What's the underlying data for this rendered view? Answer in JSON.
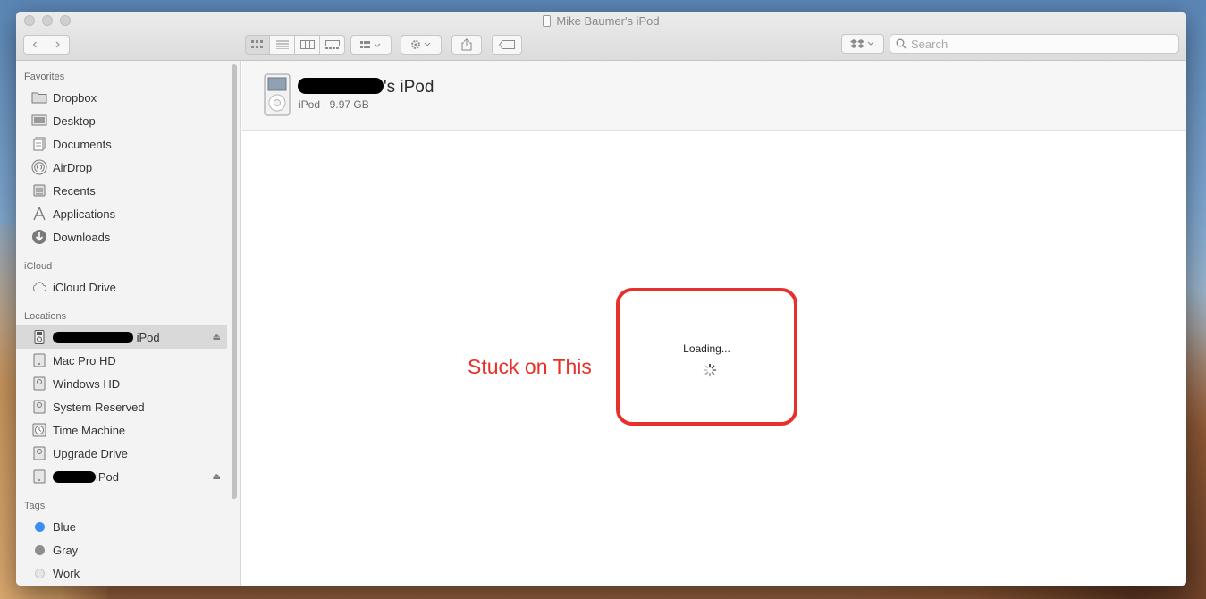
{
  "window": {
    "title": "Mike Baumer's iPod"
  },
  "toolbar": {
    "back_label": "‹",
    "forward_label": "›",
    "view_icons": [
      "icon-view-icon",
      "list-view-icon",
      "column-view-icon",
      "gallery-view-icon"
    ],
    "search_placeholder": "Search"
  },
  "sidebar": {
    "favorites_header": "Favorites",
    "favorites": [
      {
        "label": "Dropbox",
        "icon": "folder-icon"
      },
      {
        "label": "Desktop",
        "icon": "desktop-icon"
      },
      {
        "label": "Documents",
        "icon": "documents-icon"
      },
      {
        "label": "AirDrop",
        "icon": "airdrop-icon"
      },
      {
        "label": "Recents",
        "icon": "recents-icon"
      },
      {
        "label": "Applications",
        "icon": "applications-icon"
      },
      {
        "label": "Downloads",
        "icon": "downloads-icon"
      }
    ],
    "icloud_header": "iCloud",
    "icloud": [
      {
        "label": "iCloud Drive",
        "icon": "cloud-icon"
      }
    ],
    "locations_header": "Locations",
    "locations": [
      {
        "label": "iPod",
        "icon": "ipod-icon",
        "selected": true,
        "eject": true
      },
      {
        "label": "Mac Pro HD",
        "icon": "drive-icon"
      },
      {
        "label": "Windows HD",
        "icon": "drive-icon"
      },
      {
        "label": "System Reserved",
        "icon": "drive-icon"
      },
      {
        "label": "Time Machine",
        "icon": "time-machine-icon"
      },
      {
        "label": "Upgrade Drive",
        "icon": "drive-icon"
      },
      {
        "label": "iPod",
        "icon": "drive-icon",
        "eject": true
      }
    ],
    "tags_header": "Tags",
    "tags": [
      {
        "label": "Blue",
        "color": "#3b8ef3"
      },
      {
        "label": "Gray",
        "color": "#8e8e8e"
      },
      {
        "label": "Work",
        "color": "#e6e6e6"
      }
    ]
  },
  "content": {
    "device_name": "'s iPod",
    "device_subtitle": "iPod · 9.97 GB",
    "loading_text": "Loading...",
    "annotation": "Stuck on This",
    "annotation_color": "#e8302b"
  }
}
